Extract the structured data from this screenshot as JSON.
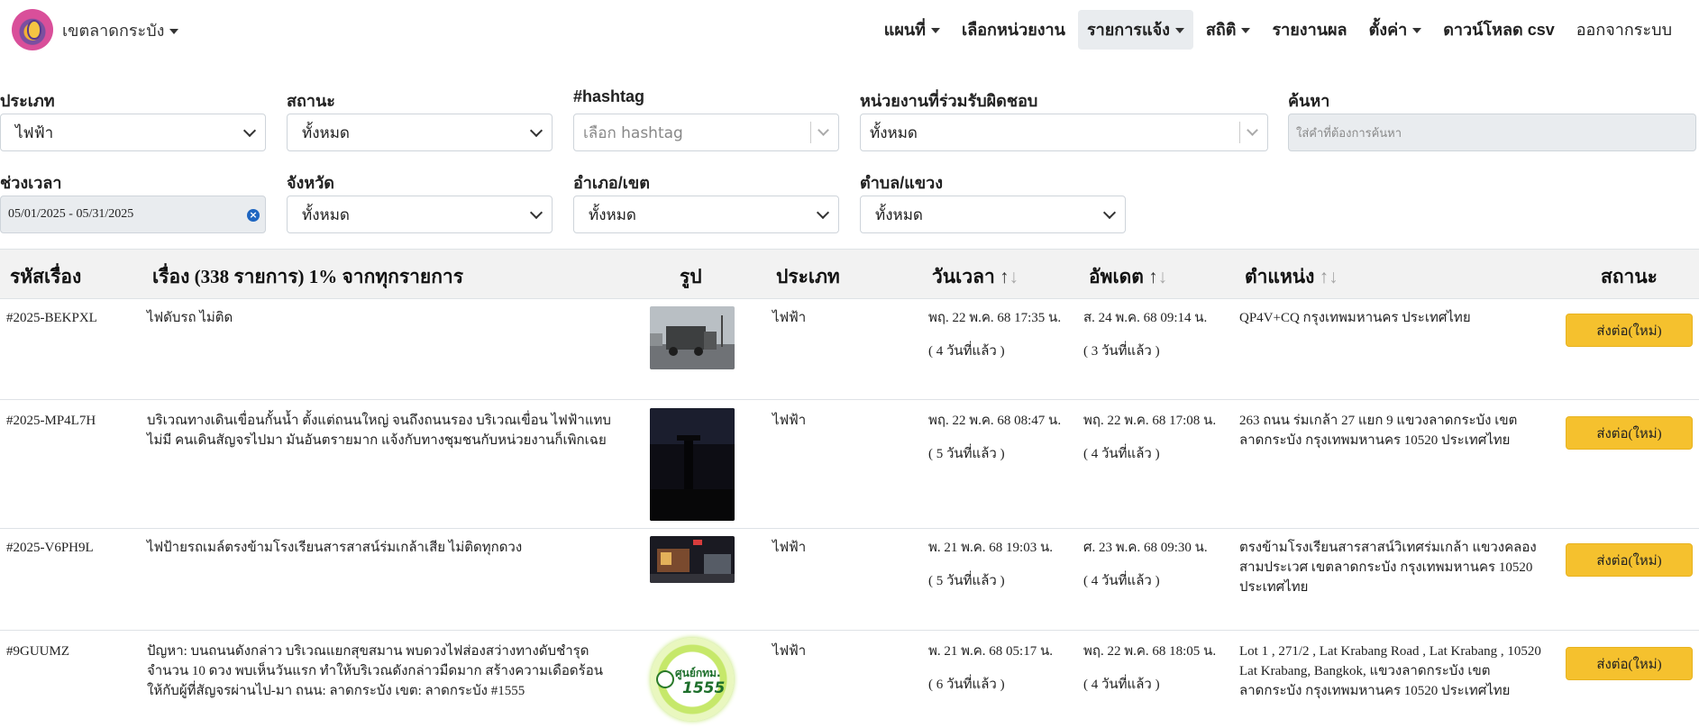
{
  "brand": {
    "title": "เขตลาดกระบัง"
  },
  "nav": [
    {
      "label": "แผนที่",
      "dropdown": true,
      "active": false
    },
    {
      "label": "เลือกหน่วยงาน",
      "dropdown": false,
      "active": false
    },
    {
      "label": "รายการแจ้ง",
      "dropdown": true,
      "active": true
    },
    {
      "label": "สถิติ",
      "dropdown": true,
      "active": false
    },
    {
      "label": "รายงานผล",
      "dropdown": false,
      "active": false
    },
    {
      "label": "ตั้งค่า",
      "dropdown": true,
      "active": false
    },
    {
      "label": "ดาวน์โหลด csv",
      "dropdown": false,
      "active": false
    },
    {
      "label": "ออกจากระบบ",
      "dropdown": false,
      "active": false
    }
  ],
  "filters": {
    "type": {
      "label": "ประเภท",
      "value": "ไฟฟ้า"
    },
    "status": {
      "label": "สถานะ",
      "value": "ทั้งหมด"
    },
    "hashtag": {
      "label": "#hashtag",
      "placeholder": "เลือก hashtag"
    },
    "agency": {
      "label": "หน่วยงานที่ร่วมรับผิดชอบ",
      "value": "ทั้งหมด"
    },
    "search": {
      "label": "ค้นหา",
      "placeholder": "ใส่คำที่ต้องการค้นหา"
    },
    "period": {
      "label": "ช่วงเวลา",
      "value": "05/01/2025 - 05/31/2025"
    },
    "province": {
      "label": "จังหวัด",
      "value": "ทั้งหมด"
    },
    "district": {
      "label": "อำเภอ/เขต",
      "value": "ทั้งหมด"
    },
    "subdistrict": {
      "label": "ตำบล/แขวง",
      "value": "ทั้งหมด"
    }
  },
  "table": {
    "headers": {
      "id": "รหัสเรื่อง",
      "title": "เรื่อง (338 รายการ) 1% จากทุกรายการ",
      "image": "รูป",
      "type": "ประเภท",
      "datetime": "วันเวลา",
      "updated": "อัพเดต",
      "location": "ตำแหน่ง",
      "status": "สถานะ"
    },
    "sort_symbol": "↑",
    "sort_symbol_down": "↓",
    "rows": [
      {
        "id": "#2025-BEKPXL",
        "title": "ไฟดับรถ ไม่ติด",
        "type": "ไฟฟ้า",
        "datetime": "พฤ. 22 พ.ค. 68 17:35 น.",
        "datetime_ago": "( 4 วันที่แล้ว )",
        "updated": "ส. 24 พ.ค. 68 09:14 น.",
        "updated_ago": "( 3 วันที่แล้ว )",
        "location": "QP4V+CQ กรุงเทพมหานคร ประเทศไทย",
        "status": "ส่งต่อ(ใหม่)",
        "image": "truck-photo"
      },
      {
        "id": "#2025-MP4L7H",
        "title": "บริเวณทางเดินเขื่อนกั้นน้ำ ตั้งแต่ถนนใหญ่ จนถึงถนนรอง บริเวณเขื่อน ไฟฟ้าแทบไม่มี คนเดินสัญจรไปมา มันอันตรายมาก แจ้งกับทางชุมชนกับหน่วยงานก็เพิกเฉย",
        "type": "ไฟฟ้า",
        "datetime": "พฤ. 22 พ.ค. 68 08:47 น.",
        "datetime_ago": "( 5 วันที่แล้ว )",
        "updated": "พฤ. 22 พ.ค. 68 17:08 น.",
        "updated_ago": "( 4 วันที่แล้ว )",
        "location": "263 ถนน ร่มเกล้า 27 แยก 9 แขวงลาดกระบัง เขตลาดกระบัง กรุงเทพมหานคร 10520 ประเทศไทย",
        "status": "ส่งต่อ(ใหม่)",
        "image": "dark-night-photo"
      },
      {
        "id": "#2025-V6PH9L",
        "title": "ไฟป้ายรถเมล์ตรงข้ามโรงเรียนสารสาสน์ร่มเกล้าเสีย ไม่ติดทุกดวง",
        "type": "ไฟฟ้า",
        "datetime": "พ. 21 พ.ค. 68 19:03 น.",
        "datetime_ago": "( 5 วันที่แล้ว )",
        "updated": "ศ. 23 พ.ค. 68 09:30 น.",
        "updated_ago": "( 4 วันที่แล้ว )",
        "location": "ตรงข้ามโรงเรียนสารสาสน์วิเทศร่มเกล้า แขวงคลองสามประเวศ เขตลาดกระบัง กรุงเทพมหานคร 10520 ประเทศไทย",
        "status": "ส่งต่อ(ใหม่)",
        "image": "bus-stop-night-photo"
      },
      {
        "id": "#9GUUMZ",
        "title": "ปัญหา: บนถนนดังกล่าว บริเวณแยกสุขสมาน พบดวงไฟส่องสว่างทางดับชำรุดจำนวน 10 ดวง พบเห็นวันแรก ทำให้บริเวณดังกล่าวมืดมาก สร้างความเดือดร้อนให้กับผู้ที่สัญจรผ่านไป-มา ถนน: ลาดกระบัง เขต: ลาดกระบัง #1555",
        "type": "ไฟฟ้า",
        "datetime": "พ. 21 พ.ค. 68 05:17 น.",
        "datetime_ago": "( 6 วันที่แล้ว )",
        "updated": "พฤ. 22 พ.ค. 68 18:05 น.",
        "updated_ago": "( 4 วันที่แล้ว )",
        "location": "Lot 1 , 271/2 , Lat Krabang Road , Lat Krabang , 10520 Lat Krabang, Bangkok, แขวงลาดกระบัง เขตลาดกระบัง กรุงเทพมหานคร 10520 ประเทศไทย",
        "status": "ส่งต่อ(ใหม่)",
        "image": "1555-logo",
        "logo_text_top": "ศูนย์กทม.",
        "logo_text_num": "1555"
      }
    ]
  }
}
